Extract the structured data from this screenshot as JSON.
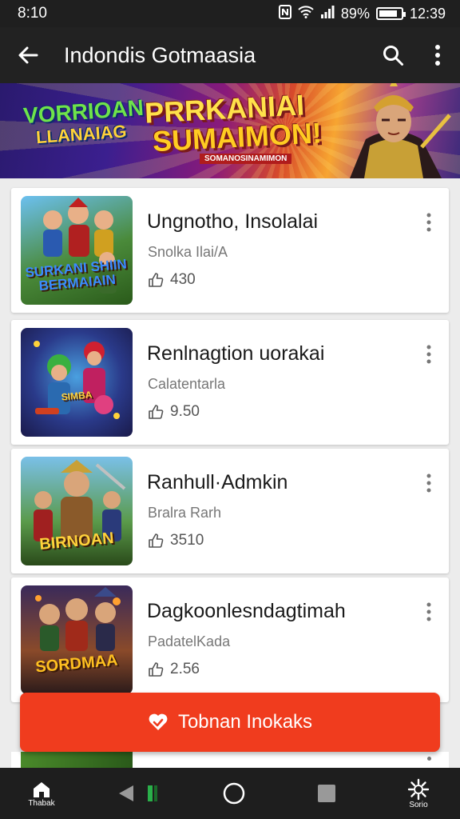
{
  "status": {
    "time": "8:10",
    "battery": "89%",
    "clock": "12:39"
  },
  "appbar": {
    "title": "Indondis Gotmaasia"
  },
  "banner": {
    "left_line1": "VORRIOAN",
    "left_line2": "LLANAIAG",
    "main_line1": "PRRKANIAI",
    "main_line2": "SUMAIMON!",
    "tagline": "SOMANOSINAMIMON"
  },
  "games": [
    {
      "name": "Ungnotho, Insolalai",
      "subtitle": "Snolka Ilai/A",
      "rating": "430",
      "thumb_text": "SURKANI SHIIN BERMAIAIN"
    },
    {
      "name": "Renlnagtion uorakai",
      "subtitle": "Calatentarla",
      "rating": "9.50",
      "thumb_text": "SIMBA"
    },
    {
      "name": "Ranhull·Admkin",
      "subtitle": "Bralra Rarh",
      "rating": "3510",
      "thumb_text": "BIRNOAN"
    },
    {
      "name": "Dagkoonlesndagtimah",
      "subtitle": "PadatelKada",
      "rating": "2.56",
      "thumb_text": "SORDMAA"
    }
  ],
  "cta": {
    "label": "Tobnan Inokaks"
  },
  "navbar": {
    "home_label": "Thabak",
    "settings_label": "Sorio"
  },
  "colors": {
    "accent": "#f03c1e",
    "appbar": "#222222"
  }
}
